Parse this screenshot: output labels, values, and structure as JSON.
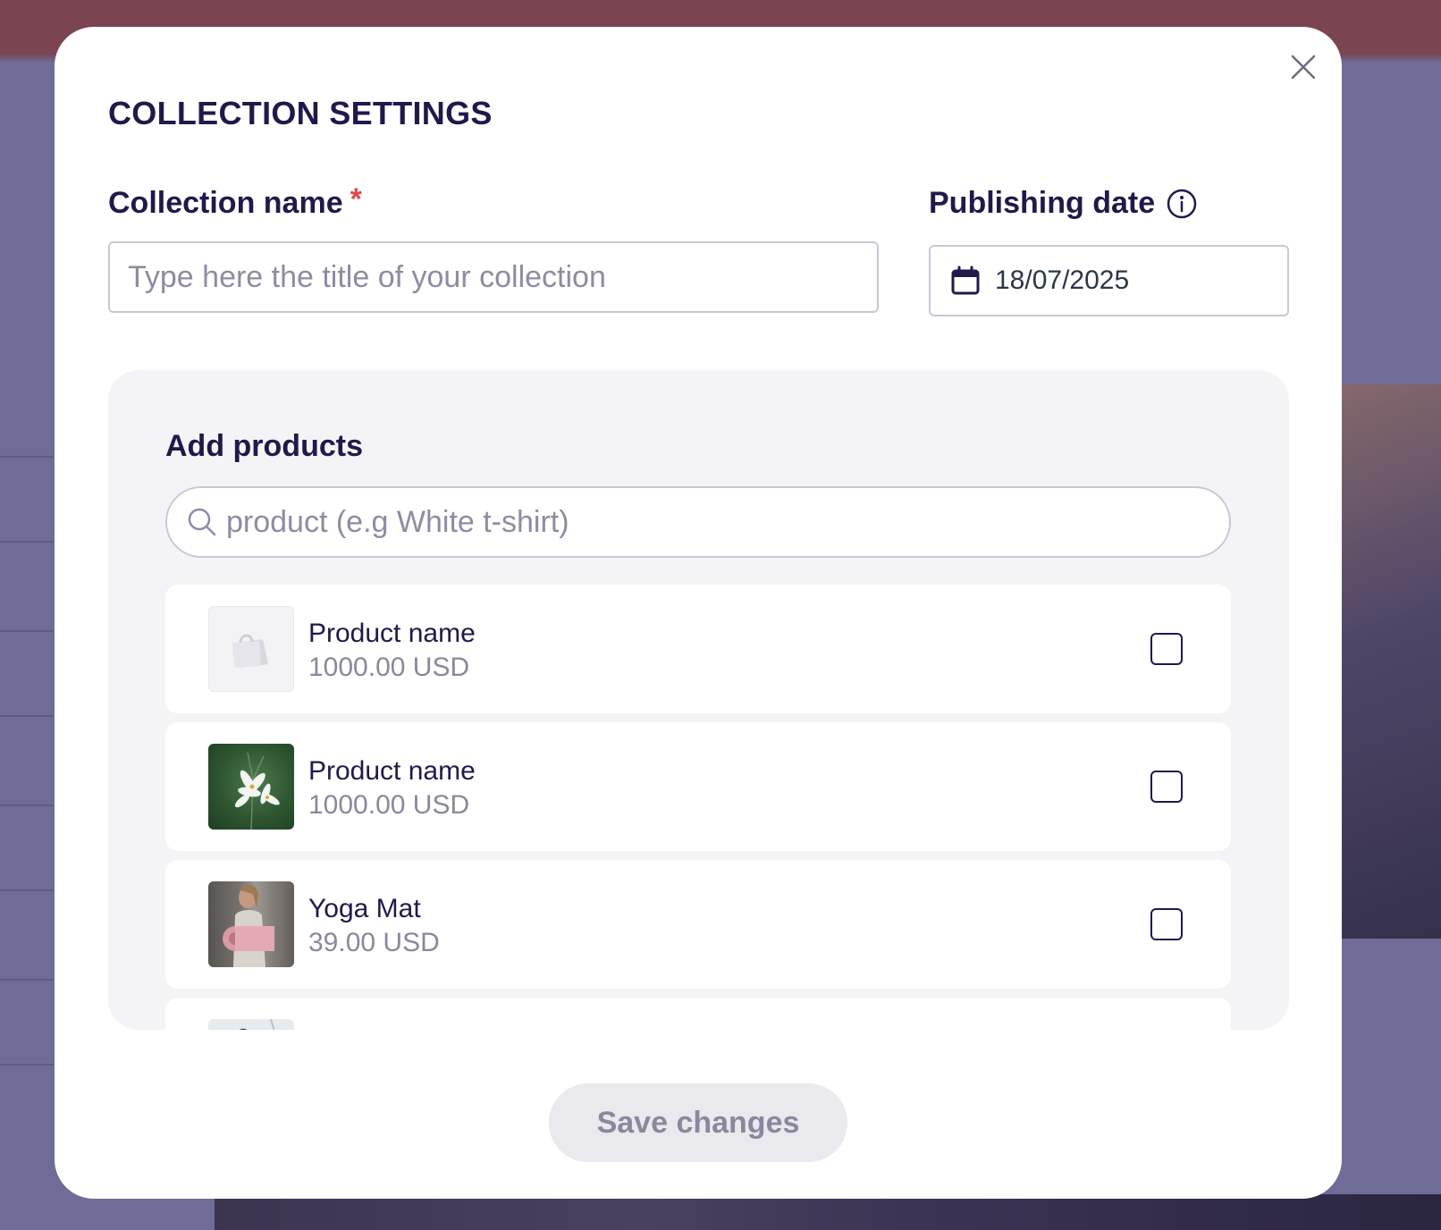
{
  "modal": {
    "title": "COLLECTION SETTINGS",
    "close_icon": "close-icon"
  },
  "collection_name": {
    "label": "Collection name",
    "required_mark": "*",
    "value": "",
    "placeholder": "Type here the title of your collection"
  },
  "publishing_date": {
    "label": "Publishing date",
    "info_icon": "info-icon",
    "calendar_icon": "calendar-icon",
    "value": "18/07/2025"
  },
  "add_products": {
    "heading": "Add products",
    "search": {
      "icon": "search-icon",
      "value": "",
      "placeholder": "product (e.g White t-shirt)"
    },
    "items": [
      {
        "name": "Product name",
        "price": "1000.00 USD",
        "checked": false,
        "thumbnail": "shopping-bag-placeholder-icon"
      },
      {
        "name": "Product name",
        "price": "1000.00 USD",
        "checked": false,
        "thumbnail": "white-lily-flowers-photo"
      },
      {
        "name": "Yoga Mat",
        "price": "39.00 USD",
        "checked": false,
        "thumbnail": "woman-holding-yoga-mat-photo"
      },
      {
        "name": "",
        "price": "",
        "checked": false,
        "thumbnail": "partially-visible-product-photo"
      }
    ]
  },
  "save_button": {
    "label": "Save changes"
  },
  "colors": {
    "primary_text": "#1f1a4a",
    "required": "#e0474c",
    "muted_text": "#8a889c",
    "border": "#c9c8d3",
    "panel_bg": "#f4f4f6",
    "disabled_button_bg": "#e9e9ee"
  }
}
